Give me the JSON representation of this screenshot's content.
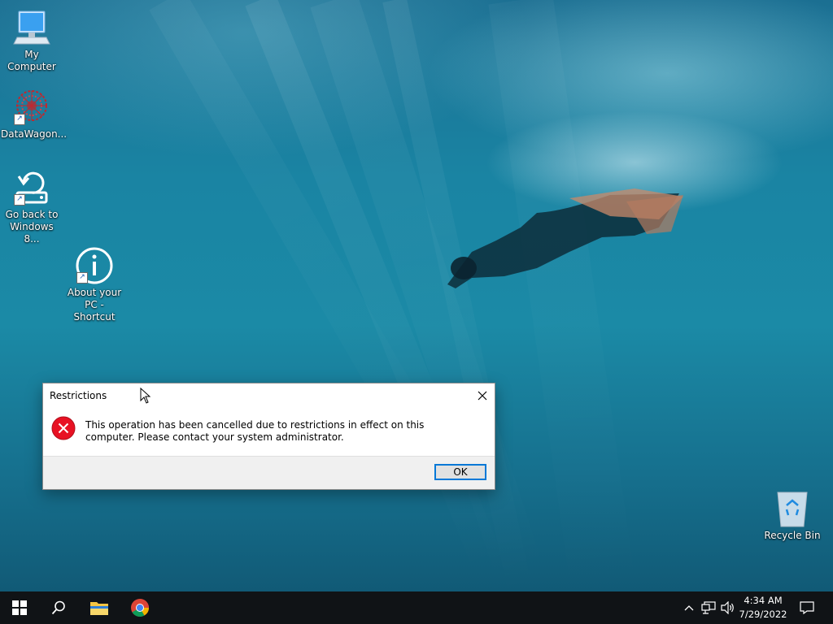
{
  "desktop": {
    "icons": [
      {
        "label": "My Computer",
        "icon": "computer-icon"
      },
      {
        "label": "DataWagon...",
        "icon": "datawagon-icon"
      },
      {
        "label": "Go back to Windows 8...",
        "icon": "go-back-icon"
      },
      {
        "label": "About your PC - Shortcut",
        "icon": "info-icon"
      },
      {
        "label": "Recycle Bin",
        "icon": "recycle-bin-icon"
      }
    ]
  },
  "dialog": {
    "title": "Restrictions",
    "message": "This operation has been cancelled due to restrictions in effect on this computer. Please contact your system administrator.",
    "ok_label": "OK",
    "close_glyph": "✕"
  },
  "taskbar": {
    "time": "4:34 AM",
    "date": "7/29/2022",
    "items": [
      "start-icon",
      "search-icon",
      "file-explorer-icon",
      "chrome-icon"
    ],
    "tray": [
      "chevron-up-icon",
      "network-icon",
      "volume-icon",
      "notification-icon"
    ]
  },
  "colors": {
    "taskbar": "#101316",
    "dialog_footer": "#f0f0f0",
    "accent": "#0078d7",
    "error": "#e81123"
  }
}
